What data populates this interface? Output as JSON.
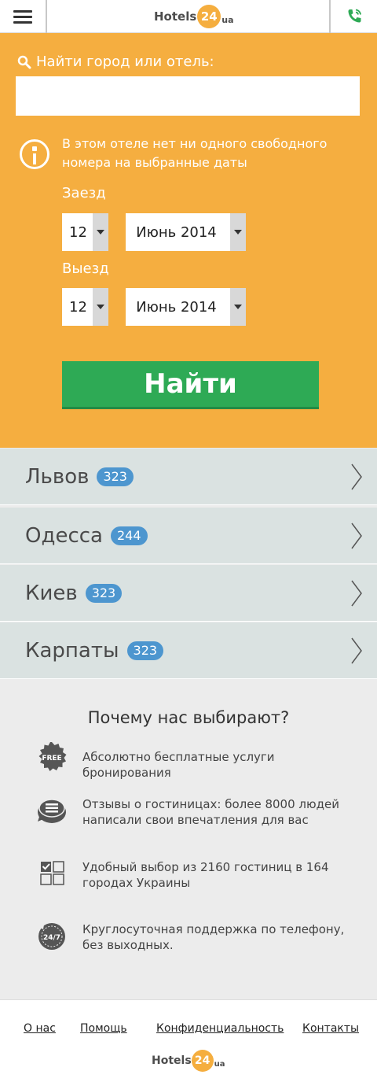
{
  "header": {
    "logo_word": "Hotels",
    "logo_number": "24",
    "logo_suffix": "ua"
  },
  "search": {
    "label": "Найти город или отель:",
    "value": "",
    "placeholder": ""
  },
  "notice": "В этом отеле нет ни одного свободного номера на выбранные даты",
  "checkin": {
    "label": "Заезд",
    "day": "12",
    "month": "Июнь 2014"
  },
  "checkout": {
    "label": "Выезд",
    "day": "12",
    "month": "Июнь 2014"
  },
  "find_button": "Найти",
  "cities": [
    {
      "name": "Львов",
      "count": "323"
    },
    {
      "name": "Одесса",
      "count": "244"
    },
    {
      "name": "Киев",
      "count": "323"
    },
    {
      "name": "Карпаты",
      "count": "323"
    }
  ],
  "features": {
    "title": "Почему нас выбирают?",
    "items": [
      {
        "icon": "free-badge-icon",
        "badge_text": "FREE",
        "text": "Абсолютно бесплатные услуги бронирования"
      },
      {
        "icon": "reviews-icon",
        "text": "Отзывы о гостиницах: более 8000 людей написали свои впечатления для вас"
      },
      {
        "icon": "choice-grid-icon",
        "text": "Удобный выбор из 2160 гостиниц в 164 городах Украины"
      },
      {
        "icon": "support-24-7-icon",
        "badge_text": "24/7",
        "text": "Круглосуточная поддержка по телефону, без выходных."
      }
    ]
  },
  "footer": {
    "links": [
      "О нас",
      "Помощь",
      "Конфиденциальность",
      "Контакты"
    ],
    "logo_word": "Hotels",
    "logo_number": "24",
    "logo_suffix": "ua"
  },
  "colors": {
    "accent_orange": "#f5ae40",
    "button_green": "#2eaa55",
    "badge_blue": "#4d96cf",
    "city_bg": "#dae2e1"
  }
}
